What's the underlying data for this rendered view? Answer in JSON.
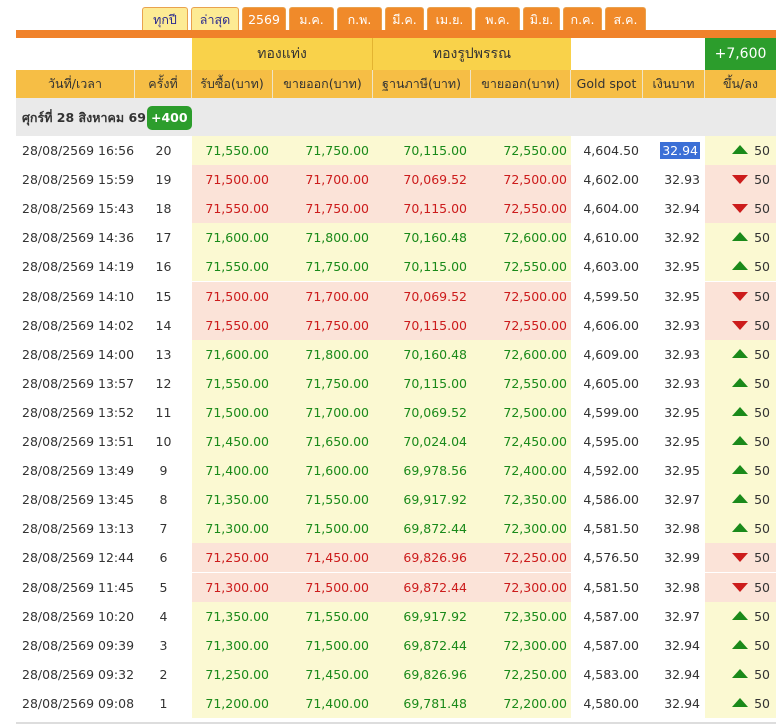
{
  "tabs": [
    {
      "label": "ทุกปี",
      "style": "light"
    },
    {
      "label": "ล่าสุด",
      "style": "light"
    },
    {
      "label": "2569",
      "style": "dark"
    },
    {
      "label": "ม.ค.",
      "style": "dark"
    },
    {
      "label": "ก.พ.",
      "style": "dark"
    },
    {
      "label": "มี.ค.",
      "style": "dark"
    },
    {
      "label": "เม.ย.",
      "style": "dark"
    },
    {
      "label": "พ.ค.",
      "style": "dark"
    },
    {
      "label": "มิ.ย.",
      "style": "dark"
    },
    {
      "label": "ก.ค.",
      "style": "dark"
    },
    {
      "label": "ส.ค.",
      "style": "dark"
    }
  ],
  "header": {
    "group_bar": "ทองแท่ง",
    "group_ornament": "ทองรูปพรรณ",
    "total_change": "+7,600",
    "cols": {
      "datetime": "วันที่/เวลา",
      "count": "ครั้งที่",
      "bar_buy": "รับซื้อ(บาท)",
      "bar_sell": "ขายออก(บาท)",
      "orn_base": "ฐานภาษี(บาท)",
      "orn_sell": "ขายออก(บาท)",
      "spot": "Gold spot",
      "thb": "เงินบาท",
      "change": "ขึ้น/ลง"
    }
  },
  "date_group": {
    "label": "ศุกร์ที่ 28 สิงหาคม 69",
    "badge": "+400"
  },
  "rows": [
    {
      "time": "28/08/2569 16:56",
      "count": "20",
      "bar_buy": "71,550.00",
      "bar_sell": "71,750.00",
      "orn_base": "70,115.00",
      "orn_sell": "72,550.00",
      "spot": "4,604.50",
      "thb": "32.94",
      "change": "50",
      "dir": "up",
      "selected": true
    },
    {
      "time": "28/08/2569 15:59",
      "count": "19",
      "bar_buy": "71,500.00",
      "bar_sell": "71,700.00",
      "orn_base": "70,069.52",
      "orn_sell": "72,500.00",
      "spot": "4,602.00",
      "thb": "32.93",
      "change": "50",
      "dir": "down"
    },
    {
      "time": "28/08/2569 15:43",
      "count": "18",
      "bar_buy": "71,550.00",
      "bar_sell": "71,750.00",
      "orn_base": "70,115.00",
      "orn_sell": "72,550.00",
      "spot": "4,604.00",
      "thb": "32.94",
      "change": "50",
      "dir": "down"
    },
    {
      "time": "28/08/2569 14:36",
      "count": "17",
      "bar_buy": "71,600.00",
      "bar_sell": "71,800.00",
      "orn_base": "70,160.48",
      "orn_sell": "72,600.00",
      "spot": "4,610.00",
      "thb": "32.92",
      "change": "50",
      "dir": "up"
    },
    {
      "time": "28/08/2569 14:19",
      "count": "16",
      "bar_buy": "71,550.00",
      "bar_sell": "71,750.00",
      "orn_base": "70,115.00",
      "orn_sell": "72,550.00",
      "spot": "4,603.00",
      "thb": "32.95",
      "change": "50",
      "dir": "up"
    },
    {
      "time": "28/08/2569 14:10",
      "count": "15",
      "bar_buy": "71,500.00",
      "bar_sell": "71,700.00",
      "orn_base": "70,069.52",
      "orn_sell": "72,500.00",
      "spot": "4,599.50",
      "thb": "32.95",
      "change": "50",
      "dir": "down"
    },
    {
      "time": "28/08/2569 14:02",
      "count": "14",
      "bar_buy": "71,550.00",
      "bar_sell": "71,750.00",
      "orn_base": "70,115.00",
      "orn_sell": "72,550.00",
      "spot": "4,606.00",
      "thb": "32.93",
      "change": "50",
      "dir": "down"
    },
    {
      "time": "28/08/2569 14:00",
      "count": "13",
      "bar_buy": "71,600.00",
      "bar_sell": "71,800.00",
      "orn_base": "70,160.48",
      "orn_sell": "72,600.00",
      "spot": "4,609.00",
      "thb": "32.93",
      "change": "50",
      "dir": "up"
    },
    {
      "time": "28/08/2569 13:57",
      "count": "12",
      "bar_buy": "71,550.00",
      "bar_sell": "71,750.00",
      "orn_base": "70,115.00",
      "orn_sell": "72,550.00",
      "spot": "4,605.00",
      "thb": "32.93",
      "change": "50",
      "dir": "up"
    },
    {
      "time": "28/08/2569 13:52",
      "count": "11",
      "bar_buy": "71,500.00",
      "bar_sell": "71,700.00",
      "orn_base": "70,069.52",
      "orn_sell": "72,500.00",
      "spot": "4,599.00",
      "thb": "32.95",
      "change": "50",
      "dir": "up"
    },
    {
      "time": "28/08/2569 13:51",
      "count": "10",
      "bar_buy": "71,450.00",
      "bar_sell": "71,650.00",
      "orn_base": "70,024.04",
      "orn_sell": "72,450.00",
      "spot": "4,595.00",
      "thb": "32.95",
      "change": "50",
      "dir": "up"
    },
    {
      "time": "28/08/2569 13:49",
      "count": "9",
      "bar_buy": "71,400.00",
      "bar_sell": "71,600.00",
      "orn_base": "69,978.56",
      "orn_sell": "72,400.00",
      "spot": "4,592.00",
      "thb": "32.95",
      "change": "50",
      "dir": "up"
    },
    {
      "time": "28/08/2569 13:45",
      "count": "8",
      "bar_buy": "71,350.00",
      "bar_sell": "71,550.00",
      "orn_base": "69,917.92",
      "orn_sell": "72,350.00",
      "spot": "4,586.00",
      "thb": "32.97",
      "change": "50",
      "dir": "up"
    },
    {
      "time": "28/08/2569 13:13",
      "count": "7",
      "bar_buy": "71,300.00",
      "bar_sell": "71,500.00",
      "orn_base": "69,872.44",
      "orn_sell": "72,300.00",
      "spot": "4,581.50",
      "thb": "32.98",
      "change": "50",
      "dir": "up"
    },
    {
      "time": "28/08/2569 12:44",
      "count": "6",
      "bar_buy": "71,250.00",
      "bar_sell": "71,450.00",
      "orn_base": "69,826.96",
      "orn_sell": "72,250.00",
      "spot": "4,576.50",
      "thb": "32.99",
      "change": "50",
      "dir": "down"
    },
    {
      "time": "28/08/2569 11:45",
      "count": "5",
      "bar_buy": "71,300.00",
      "bar_sell": "71,500.00",
      "orn_base": "69,872.44",
      "orn_sell": "72,300.00",
      "spot": "4,581.50",
      "thb": "32.98",
      "change": "50",
      "dir": "down"
    },
    {
      "time": "28/08/2569 10:20",
      "count": "4",
      "bar_buy": "71,350.00",
      "bar_sell": "71,550.00",
      "orn_base": "69,917.92",
      "orn_sell": "72,350.00",
      "spot": "4,587.00",
      "thb": "32.97",
      "change": "50",
      "dir": "up"
    },
    {
      "time": "28/08/2569 09:39",
      "count": "3",
      "bar_buy": "71,300.00",
      "bar_sell": "71,500.00",
      "orn_base": "69,872.44",
      "orn_sell": "72,300.00",
      "spot": "4,587.00",
      "thb": "32.94",
      "change": "50",
      "dir": "up"
    },
    {
      "time": "28/08/2569 09:32",
      "count": "2",
      "bar_buy": "71,250.00",
      "bar_sell": "71,450.00",
      "orn_base": "69,826.96",
      "orn_sell": "72,250.00",
      "spot": "4,583.00",
      "thb": "32.94",
      "change": "50",
      "dir": "up"
    },
    {
      "time": "28/08/2569 09:08",
      "count": "1",
      "bar_buy": "71,200.00",
      "bar_sell": "71,400.00",
      "orn_base": "69,781.48",
      "orn_sell": "72,200.00",
      "spot": "4,580.00",
      "thb": "32.94",
      "change": "50",
      "dir": "up"
    }
  ]
}
